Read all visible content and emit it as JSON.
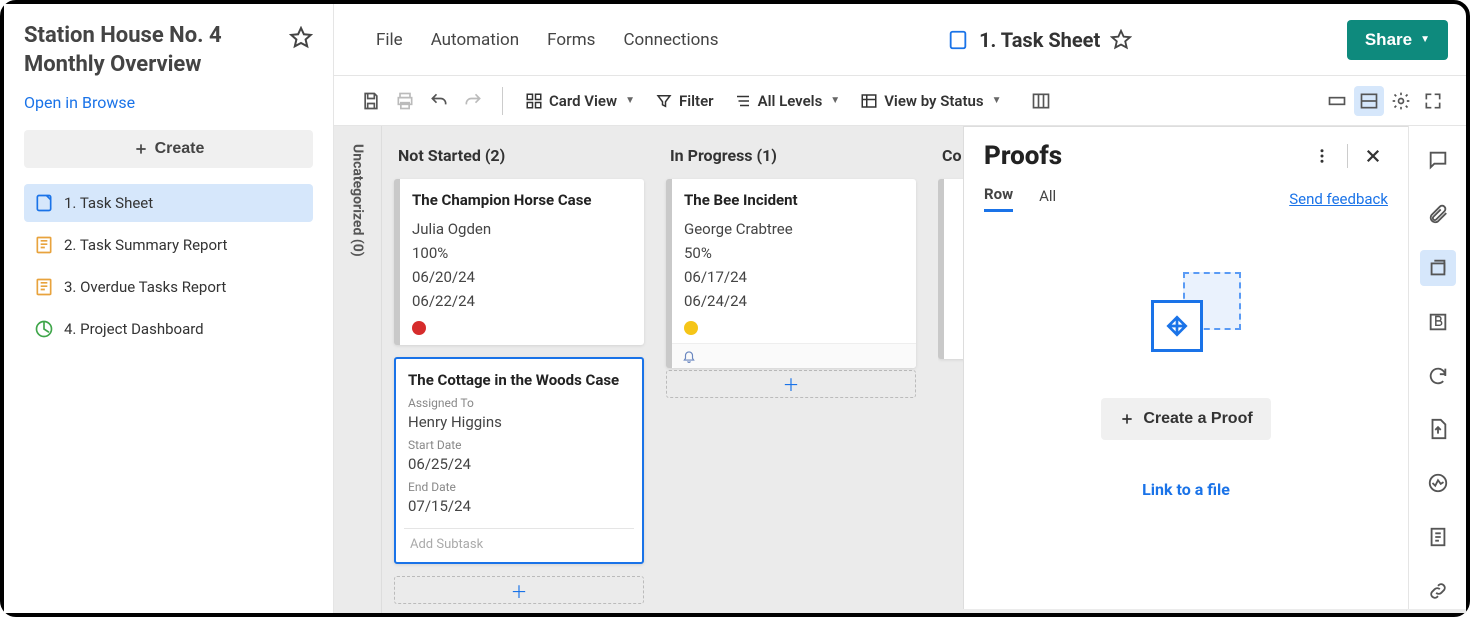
{
  "sidebar": {
    "title": "Station House No. 4 Monthly Overview",
    "open_browse": "Open in Browse",
    "create_label": "Create",
    "items": [
      {
        "label": "1. Task Sheet"
      },
      {
        "label": "2. Task Summary Report"
      },
      {
        "label": "3. Overdue Tasks Report"
      },
      {
        "label": "4. Project Dashboard"
      }
    ]
  },
  "menubar": {
    "items": [
      "File",
      "Automation",
      "Forms",
      "Connections"
    ],
    "sheet_name": "1. Task Sheet",
    "share_label": "Share"
  },
  "toolbar": {
    "card_view": "Card View",
    "filter": "Filter",
    "all_levels": "All Levels",
    "view_by": "View by Status"
  },
  "board": {
    "uncategorized_label": "Uncategorized (0)",
    "columns": [
      {
        "title": "Not Started (2)",
        "cards": [
          {
            "title": "The Champion Horse Case",
            "assignee": "Julia Ogden",
            "percent": "100%",
            "start": "06/20/24",
            "end": "06/22/24",
            "dot_color": "#d62c2c"
          },
          {
            "title": "The Cottage in the Woods Case",
            "assigned_label": "Assigned To",
            "assignee": "Henry Higgins",
            "start_label": "Start Date",
            "start": "06/25/24",
            "end_label": "End Date",
            "end": "07/15/24",
            "add_subtask": "Add Subtask"
          }
        ]
      },
      {
        "title": "In Progress (1)",
        "cards": [
          {
            "title": "The Bee Incident",
            "assignee": "George Crabtree",
            "percent": "50%",
            "start": "06/17/24",
            "end": "06/24/24",
            "dot_color": "#f5c518"
          }
        ]
      },
      {
        "title": "Co"
      }
    ]
  },
  "proofs": {
    "title": "Proofs",
    "tabs": {
      "row": "Row",
      "all": "All"
    },
    "feedback": "Send feedback",
    "create_label": "Create a Proof",
    "link_label": "Link to a file"
  }
}
